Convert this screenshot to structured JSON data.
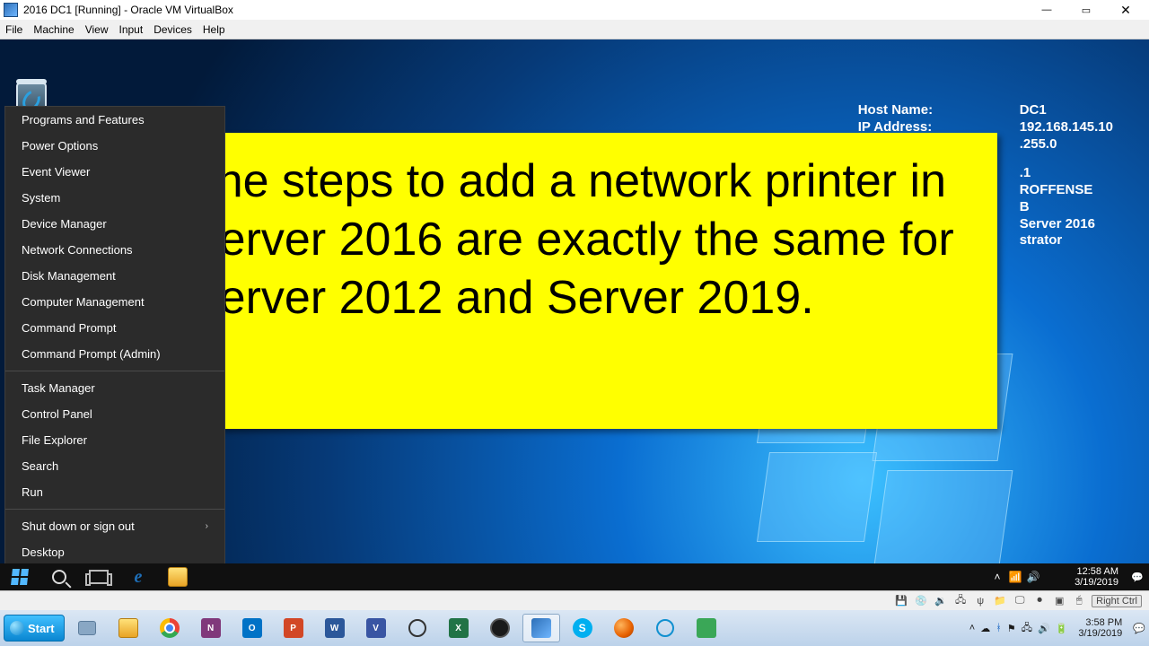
{
  "vb": {
    "title": "2016 DC1 [Running] - Oracle VM VirtualBox",
    "menu": [
      "File",
      "Machine",
      "View",
      "Input",
      "Devices",
      "Help"
    ],
    "status_hint": "Right Ctrl"
  },
  "guest": {
    "sysinfo": {
      "labels": {
        "host": "Host Name:",
        "ip": "IP Address:"
      },
      "host": "DC1",
      "ip": "192.168.145.10",
      "mask_tail": ".255.0",
      "gw_tail": ".1",
      "domain_tail": "ROFFENSE",
      "ram_tail": "B",
      "os_tail": "Server 2016",
      "user_tail": "strator"
    },
    "winx": {
      "g1": [
        "Programs and Features",
        "Power Options",
        "Event Viewer",
        "System",
        "Device Manager",
        "Network Connections",
        "Disk Management",
        "Computer Management",
        "Command Prompt",
        "Command Prompt (Admin)"
      ],
      "g2": [
        "Task Manager",
        "Control Panel",
        "File Explorer",
        "Search",
        "Run"
      ],
      "g3_sub": "Shut down or sign out",
      "g3_desktop": "Desktop"
    },
    "clock": {
      "time": "12:58 AM",
      "date": "3/19/2019"
    }
  },
  "note": "The steps to add a network printer in Server 2016 are exactly the same for Server 2012 and Server 2019.",
  "host": {
    "start_label": "Start",
    "clock": {
      "time": "3:58 PM",
      "date": "3/19/2019"
    }
  }
}
